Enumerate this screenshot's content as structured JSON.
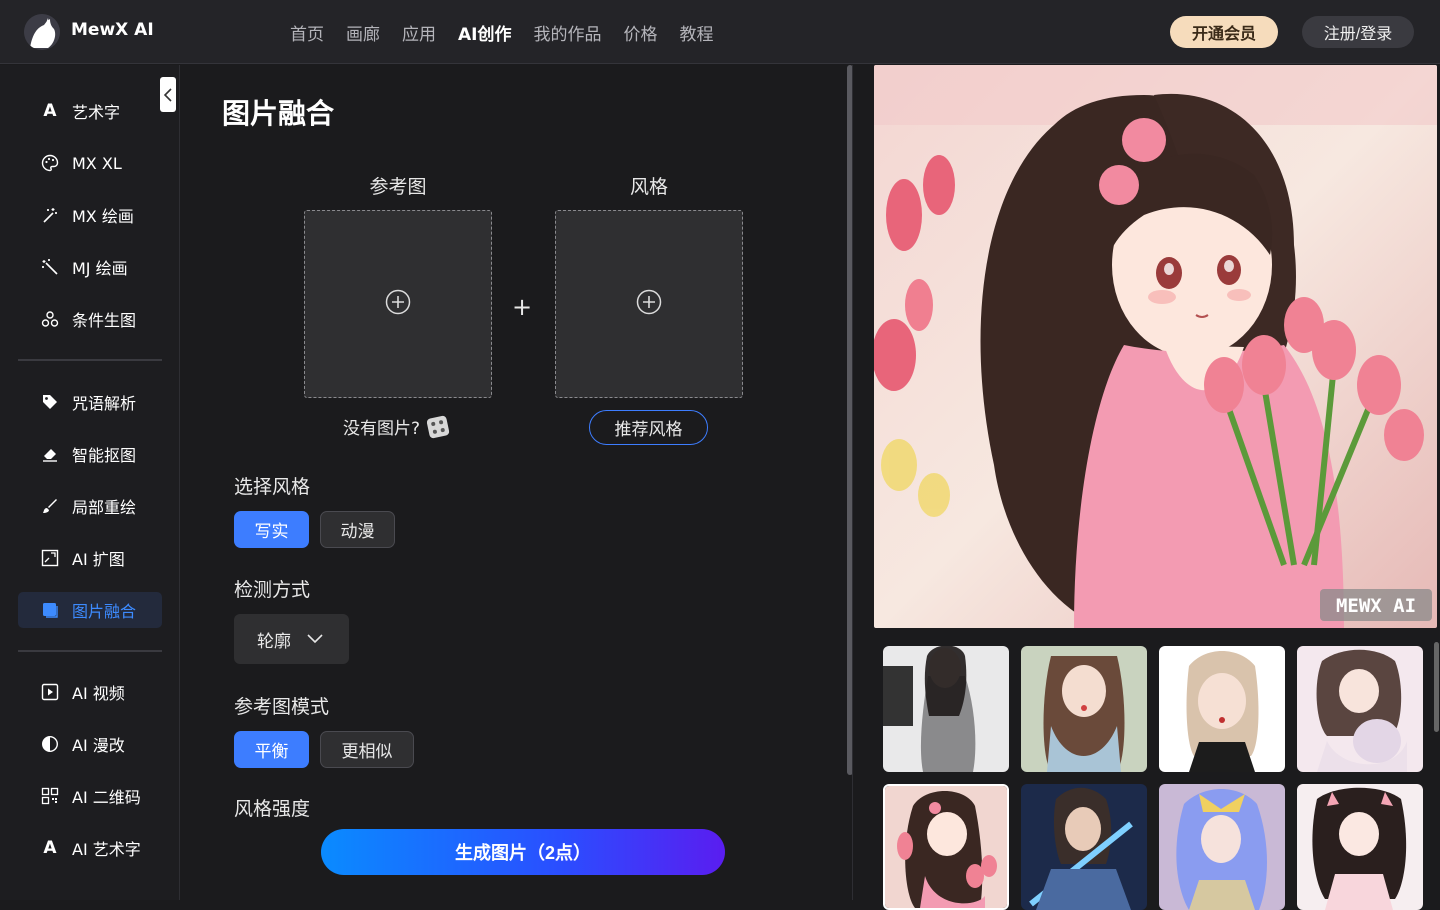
{
  "header": {
    "brand": "MewX AI",
    "nav": [
      {
        "label": "首页",
        "active": false
      },
      {
        "label": "画廊",
        "active": false
      },
      {
        "label": "应用",
        "active": false
      },
      {
        "label": "AI创作",
        "active": true
      },
      {
        "label": "我的作品",
        "active": false
      },
      {
        "label": "价格",
        "active": false
      },
      {
        "label": "教程",
        "active": false
      }
    ],
    "vip_label": "开通会员",
    "login_label": "注册/登录"
  },
  "sidebar": {
    "collapse_icon": "chevron-left-icon",
    "items": [
      {
        "label": "艺术字",
        "icon": "letter-a-icon"
      },
      {
        "label": "MX XL",
        "icon": "palette-icon"
      },
      {
        "label": "MX 绘画",
        "icon": "magic-wand-icon"
      },
      {
        "label": "MJ 绘画",
        "icon": "sparkle-wand-icon"
      },
      {
        "label": "条件生图",
        "icon": "nodes-icon"
      },
      {
        "label": "咒语解析",
        "icon": "tag-icon"
      },
      {
        "label": "智能抠图",
        "icon": "eraser-icon"
      },
      {
        "label": "局部重绘",
        "icon": "brush-icon"
      },
      {
        "label": "AI 扩图",
        "icon": "expand-image-icon"
      },
      {
        "label": "图片融合",
        "icon": "image-merge-icon",
        "active": true
      },
      {
        "label": "AI 视频",
        "icon": "video-icon"
      },
      {
        "label": "AI 漫改",
        "icon": "half-circle-icon"
      },
      {
        "label": "AI 二维码",
        "icon": "qr-code-icon"
      },
      {
        "label": "AI 艺术字",
        "icon": "letter-a-icon"
      }
    ]
  },
  "main": {
    "title": "图片融合",
    "reference_label": "参考图",
    "style_label": "风格",
    "no_image_text": "没有图片?",
    "recommend_style": "推荐风格",
    "select_style": {
      "label": "选择风格",
      "options": [
        {
          "label": "写实",
          "selected": true
        },
        {
          "label": "动漫",
          "selected": false
        }
      ]
    },
    "detect_mode": {
      "label": "检测方式",
      "value": "轮廓"
    },
    "ref_mode": {
      "label": "参考图模式",
      "options": [
        {
          "label": "平衡",
          "selected": true
        },
        {
          "label": "更相似",
          "selected": false
        }
      ]
    },
    "strength_label": "风格强度",
    "generate_label": "生成图片（2点）"
  },
  "preview": {
    "watermark": "MEWX AI"
  },
  "colors": {
    "accent": "#3d7dff",
    "vip": "#f6dcbc",
    "bg": "#1b1b1d"
  }
}
